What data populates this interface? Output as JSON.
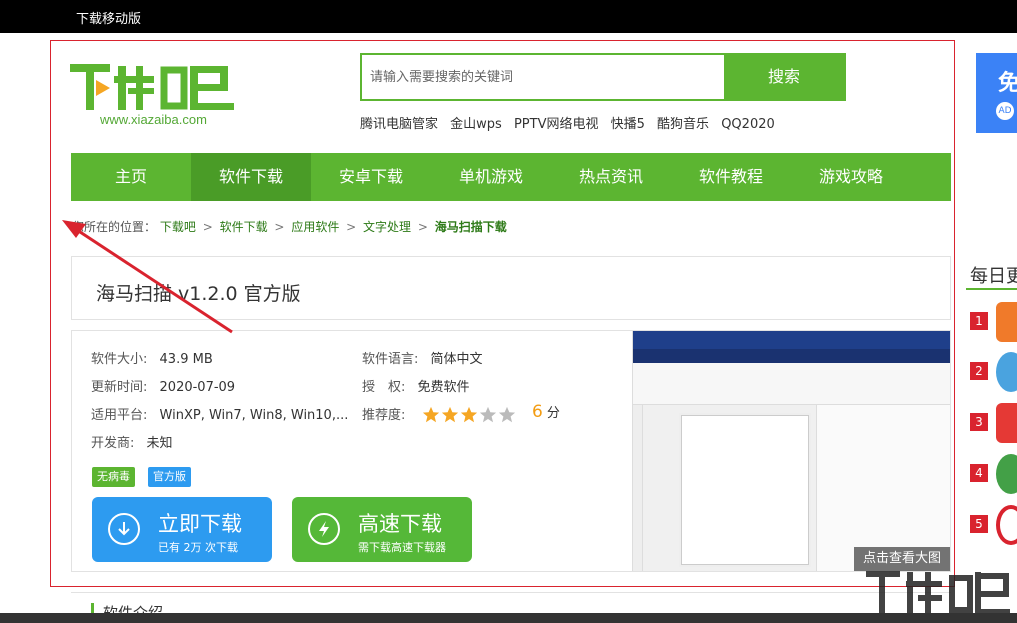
{
  "topbar": {
    "mobile_link": "下载移动版"
  },
  "logo": {
    "text": "下载吧",
    "url": "www.xiazaiba.com"
  },
  "search": {
    "placeholder": "请输入需要搜索的关键词",
    "button": "搜索"
  },
  "hot_keywords": [
    "腾讯电脑管家",
    "金山wps",
    "PPTV网络电视",
    "快播5",
    "酷狗音乐",
    "QQ2020"
  ],
  "nav": {
    "items": [
      "主页",
      "软件下载",
      "安卓下载",
      "单机游戏",
      "热点资讯",
      "软件教程",
      "游戏攻略"
    ],
    "active": "软件下载"
  },
  "breadcrumb": {
    "prefix": "您所在的位置：",
    "links": [
      "下载吧",
      "软件下载",
      "应用软件",
      "文字处理"
    ],
    "current": "海马扫描下载",
    "separator": ">"
  },
  "software": {
    "title": "海马扫描 v1.2.0 官方版",
    "size_label": "软件大小:",
    "size": "43.9 MB",
    "language_label": "软件语言:",
    "language": "简体中文",
    "updated_label": "更新时间:",
    "updated": "2020-07-09",
    "license_label": "授　权:",
    "license": "免费软件",
    "platform_label": "适用平台:",
    "platform": "WinXP, Win7, Win8, Win10,...",
    "rating_label": "推荐度:",
    "rating_stars": 3,
    "rating_max": 5,
    "score": "6",
    "score_unit": "分",
    "developer_label": "开发商:",
    "developer": "未知",
    "badges": [
      "无病毒",
      "官方版"
    ],
    "download_main": "立即下载",
    "download_sub": "已有 2万 次下载",
    "fast_main": "高速下载",
    "fast_sub": "需下载高速下载器",
    "view_big": "点击查看大图"
  },
  "sidebar": {
    "ad_text": "免",
    "ad_badge": "AD",
    "rank_title": "每日更",
    "rank_numbers": [
      "1",
      "2",
      "3",
      "4",
      "5"
    ]
  },
  "intro": {
    "label": "软件介绍"
  },
  "colors": {
    "brand_green": "#5cb531",
    "nav_active": "#4a9c27",
    "download_blue": "#2d9bf0",
    "fast_green": "#55b838",
    "star": "#f5a623",
    "score": "#f39c12",
    "highlight_red": "#d9232e"
  }
}
